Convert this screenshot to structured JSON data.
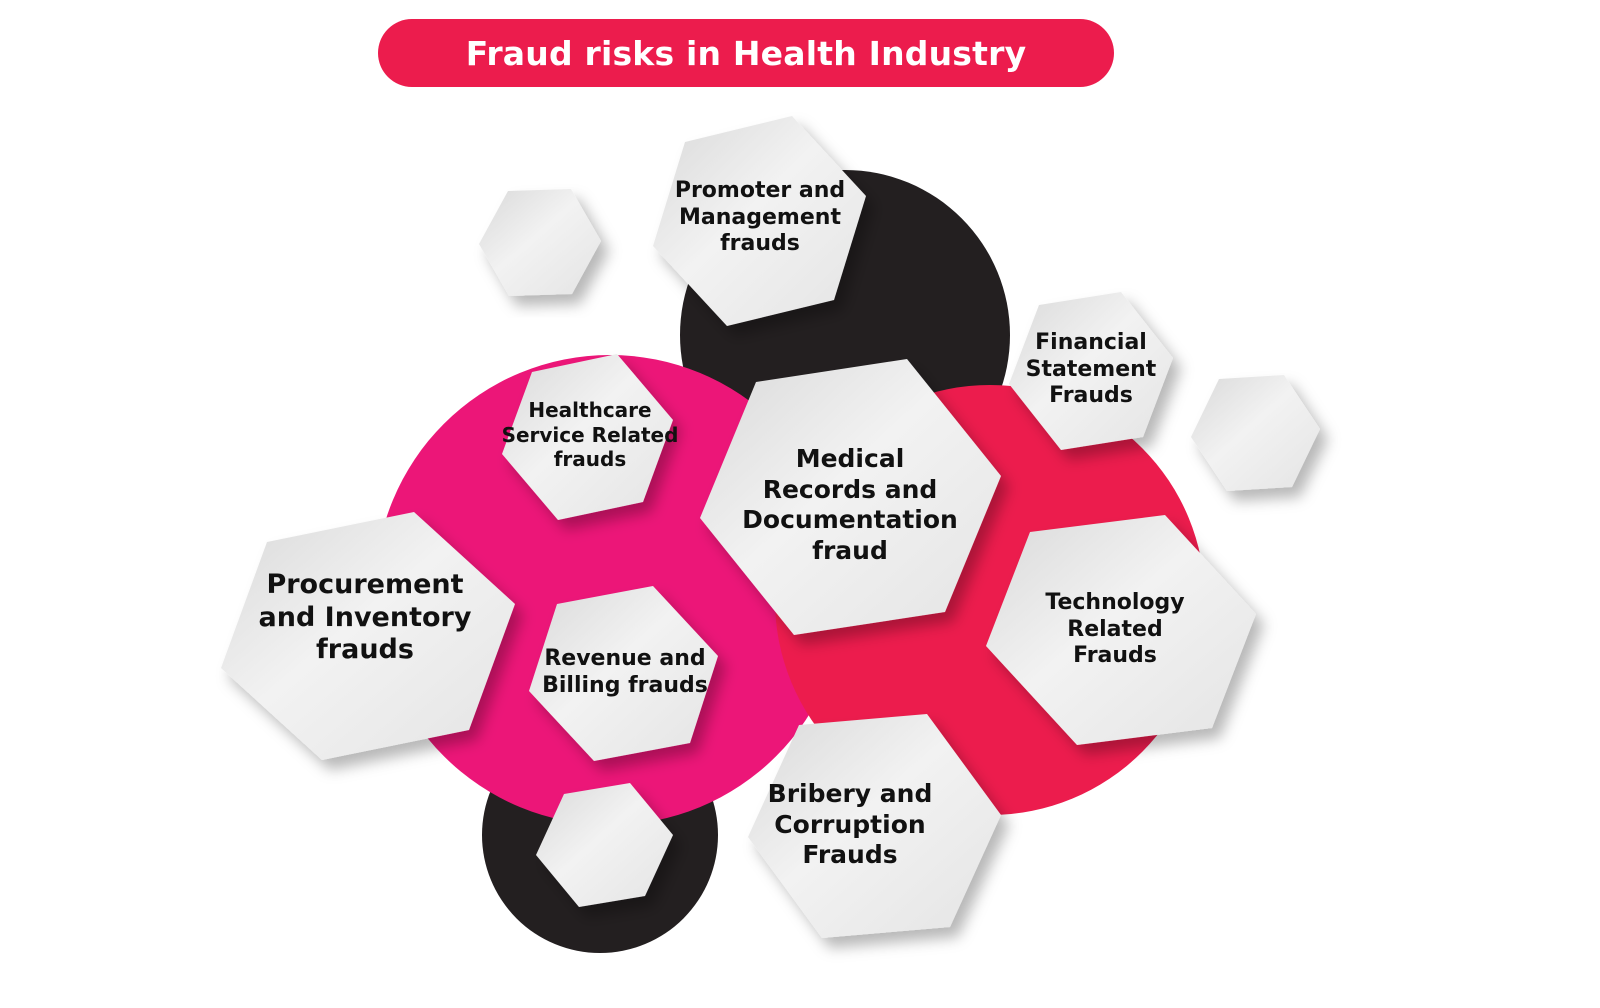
{
  "title": "Fraud risks in Health Industry",
  "colors": {
    "accent": "#ec1c4d",
    "dark": "#231f20",
    "hex_fill": "#e6e6e6",
    "text": "#111111"
  },
  "nodes": [
    {
      "id": "promoter",
      "label": "Promoter and\nManagement\nfrauds"
    },
    {
      "id": "financial",
      "label": "Financial\nStatement\nFrauds"
    },
    {
      "id": "healthcare",
      "label": "Healthcare\nService Related\nfrauds"
    },
    {
      "id": "medical",
      "label": "Medical\nRecords and\nDocumentation\nfraud"
    },
    {
      "id": "procurement",
      "label": "Procurement\nand Inventory\nfrauds"
    },
    {
      "id": "revenue",
      "label": "Revenue and\nBilling frauds"
    },
    {
      "id": "technology",
      "label": "Technology\nRelated\nFrauds"
    },
    {
      "id": "bribery",
      "label": "Bribery and\nCorruption\nFrauds"
    }
  ]
}
